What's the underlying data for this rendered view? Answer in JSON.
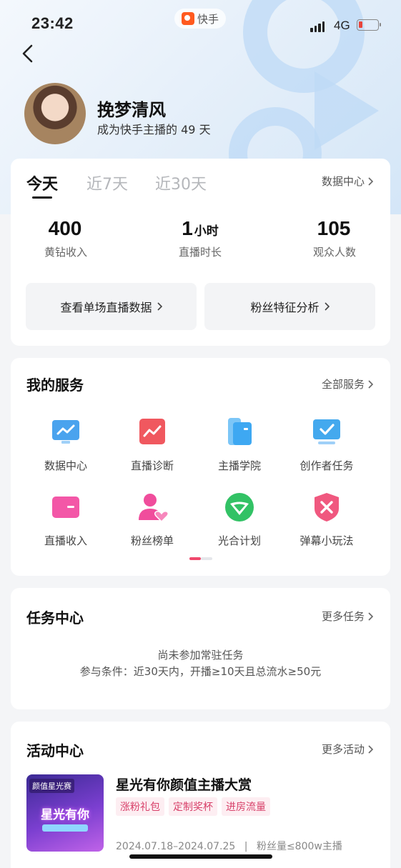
{
  "status_bar": {
    "time": "23:42",
    "app_name": "快手",
    "network": "4G"
  },
  "profile": {
    "name": "挽梦清风",
    "subtitle_prefix": "成为快手主播的",
    "days": "49",
    "subtitle_suffix": "天"
  },
  "stats": {
    "tabs": [
      "今天",
      "近7天",
      "近30天"
    ],
    "data_center_link": "数据中心",
    "items": [
      {
        "value": "400",
        "unit": "",
        "label": "黄钻收入"
      },
      {
        "value": "1",
        "unit": "小时",
        "label": "直播时长"
      },
      {
        "value": "105",
        "unit": "",
        "label": "观众人数"
      }
    ],
    "buttons": [
      "查看单场直播数据",
      "粉丝特征分析"
    ]
  },
  "services": {
    "title": "我的服务",
    "link": "全部服务",
    "items": [
      {
        "label": "数据中心",
        "icon": "chart-monitor-icon",
        "color": "#4aa3ee"
      },
      {
        "label": "直播诊断",
        "icon": "diagnosis-chart-icon",
        "color": "#f0585f"
      },
      {
        "label": "主播学院",
        "icon": "book-icon",
        "color": "#3ea8f2"
      },
      {
        "label": "创作者任务",
        "icon": "checked-monitor-icon",
        "color": "#44a9ee"
      },
      {
        "label": "直播收入",
        "icon": "card-icon",
        "color": "#f357a7"
      },
      {
        "label": "粉丝榜单",
        "icon": "fan-heart-icon",
        "color": "#f04d9c"
      },
      {
        "label": "光合计划",
        "icon": "leaf-check-icon",
        "color": "#32c265"
      },
      {
        "label": "弹幕小玩法",
        "icon": "shield-x-icon",
        "color": "#f0587f"
      }
    ],
    "page_indicator": {
      "pages": 2,
      "current": 1
    }
  },
  "tasks": {
    "title": "任务中心",
    "link": "更多任务",
    "empty_line1": "尚未参加常驻任务",
    "empty_line2": "参与条件：近30天内，开播≥10天且总流水≥50元"
  },
  "activities": {
    "title": "活动中心",
    "link": "更多活动",
    "item": {
      "poster_tag": "颜值星光赛",
      "poster_title": "星光有你",
      "title": "星光有你颜值主播大赏",
      "tags": [
        "涨粉礼包",
        "定制奖杯",
        "进房流量"
      ],
      "dates": "2024.07.18–2024.07.25",
      "condition": "粉丝量≤800w主播"
    }
  },
  "colors": {
    "accent": "#f0486c",
    "text": "#222222",
    "link": "#555555",
    "background": "#f4f5f7"
  }
}
